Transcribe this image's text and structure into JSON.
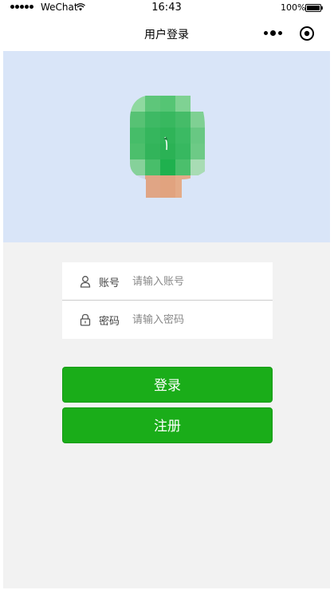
{
  "status_bar": {
    "carrier": "WeChat",
    "time": "16:43",
    "battery": "100%"
  },
  "nav": {
    "title": "用户登录"
  },
  "form": {
    "account_label": "账号",
    "account_placeholder": "请输入账号",
    "password_label": "密码",
    "password_placeholder": "请输入密码"
  },
  "buttons": {
    "login": "登录",
    "register": "注册"
  },
  "colors": {
    "primary": "#1aad19",
    "hero_bg": "#d9e5f8",
    "page_bg": "#f2f2f2"
  },
  "icons": [
    "wifi-icon",
    "battery-icon",
    "more-icon",
    "target-icon",
    "user-icon",
    "lock-icon"
  ]
}
